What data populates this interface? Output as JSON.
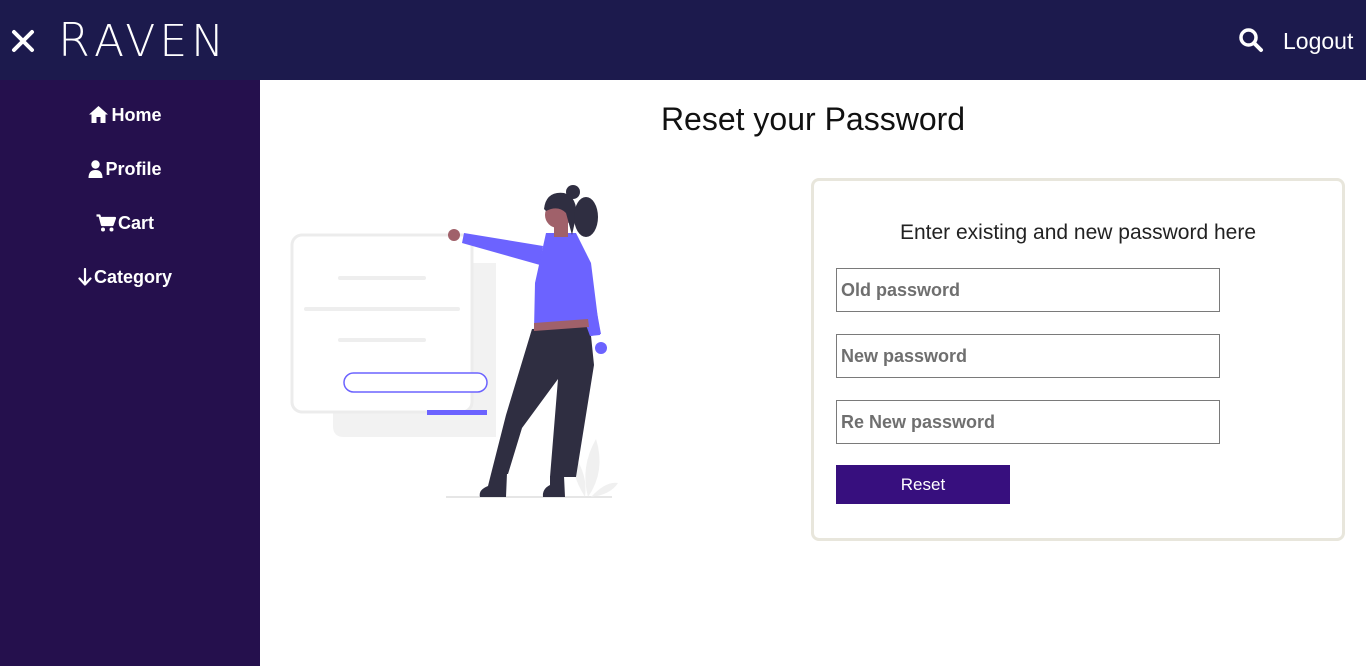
{
  "header": {
    "brand": "Raven",
    "brand_initial": "R",
    "brand_rest": "AVEN",
    "close_icon": "close-icon",
    "search_icon": "search-icon",
    "logout_label": "Logout",
    "background": "#1c1a4d"
  },
  "sidebar": {
    "background": "#25104d",
    "items": [
      {
        "label": "Home",
        "icon": "home-icon"
      },
      {
        "label": "Profile",
        "icon": "user-icon"
      },
      {
        "label": "Cart",
        "icon": "cart-icon"
      },
      {
        "label": "Category",
        "icon": "arrow-down-icon"
      }
    ]
  },
  "main": {
    "title": "Reset your Password",
    "illustration": "forgot-password-illustration",
    "form": {
      "heading": "Enter existing and new password here",
      "fields": [
        {
          "placeholder": "Old password",
          "value": ""
        },
        {
          "placeholder": "New password",
          "value": ""
        },
        {
          "placeholder": "Re New password",
          "value": ""
        }
      ],
      "submit_label": "Reset",
      "accent": "#370f7e"
    }
  }
}
